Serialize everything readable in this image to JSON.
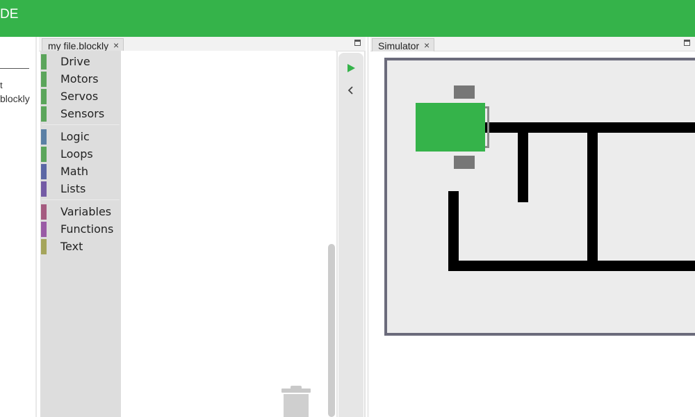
{
  "app": {
    "title": "DE",
    "accent_color": "#35b34a"
  },
  "file_panel": {
    "file_line1": "t",
    "file_line2": "blockly"
  },
  "editor": {
    "tab_label": "my file.blockly",
    "tab_close": "×",
    "toolbox": {
      "groups": [
        [
          {
            "label": "Drive",
            "color": "#5ba55b"
          },
          {
            "label": "Motors",
            "color": "#5ba55b"
          },
          {
            "label": "Servos",
            "color": "#5ba55b"
          },
          {
            "label": "Sensors",
            "color": "#5ba55b"
          }
        ],
        [
          {
            "label": "Logic",
            "color": "#5b80a5"
          },
          {
            "label": "Loops",
            "color": "#5ba55b"
          },
          {
            "label": "Math",
            "color": "#5b67a5"
          },
          {
            "label": "Lists",
            "color": "#745ba5"
          }
        ],
        [
          {
            "label": "Variables",
            "color": "#a55b80"
          },
          {
            "label": "Functions",
            "color": "#995ba5"
          },
          {
            "label": "Text",
            "color": "#a5a55b"
          }
        ]
      ]
    },
    "toolbar": {
      "run_icon": "play-icon",
      "collapse_icon": "chevron-left-icon"
    },
    "trash_icon": "trash-icon"
  },
  "simulator": {
    "tab_label": "Simulator",
    "tab_close": "×",
    "robot_color": "#35b34a",
    "wall_color": "#000000",
    "floor_color": "#ececec",
    "frame_color": "#6b6b7b"
  }
}
